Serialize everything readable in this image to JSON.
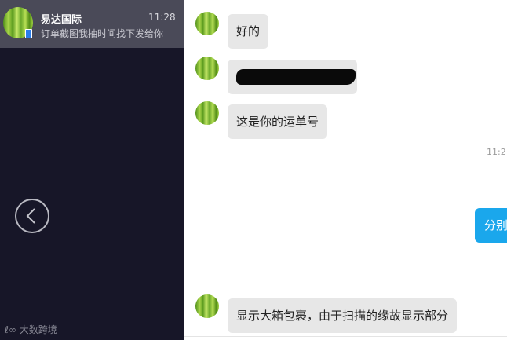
{
  "sidebar": {
    "conversation": {
      "name": "易达国际",
      "time": "11:28",
      "preview": "订单截图我抽时间找下发给你"
    },
    "back_icon": "chevron-left-icon",
    "watermark": "大数跨境"
  },
  "chat": {
    "messages": [
      {
        "text": "好的"
      },
      {
        "text": ""
      },
      {
        "text": "这是你的运单号"
      },
      {
        "text": "显示大箱包裹，由于扫描的缘故显示部分"
      }
    ],
    "timestamp": "11:2",
    "sent_message": "分别"
  },
  "colors": {
    "sidebar_bg": "#171628",
    "selected_conv_bg": "#4a4a58",
    "incoming_bubble": "#e7e7e7",
    "outgoing_bubble": "#1aa7ec"
  }
}
